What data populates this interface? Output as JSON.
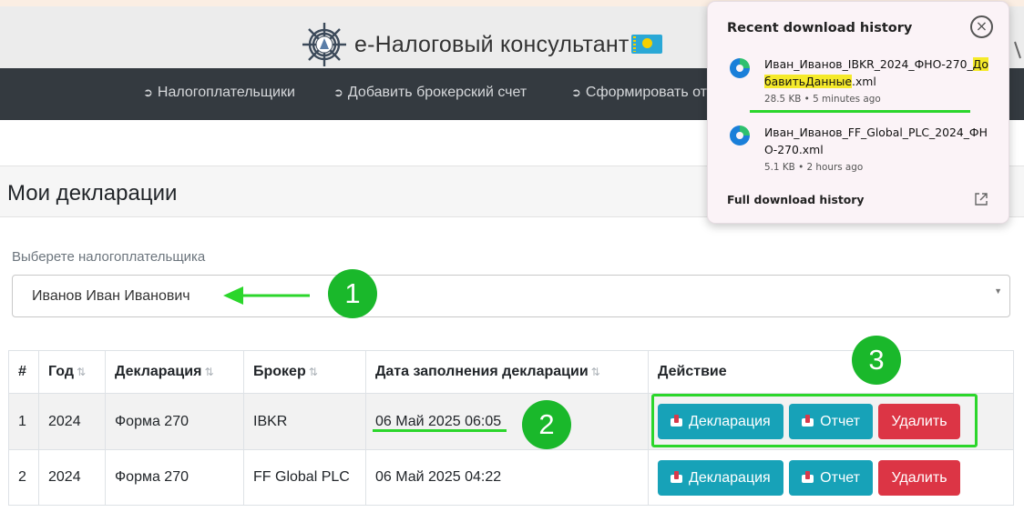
{
  "site": {
    "title": "е-Налоговый консультант",
    "logo_icon": "ship-wheel-icon",
    "flag_icon": "kazakhstan-flag-icon"
  },
  "nav": {
    "items": [
      {
        "label": "Налогоплательщики",
        "icon": "arrow-circle-icon"
      },
      {
        "label": "Добавить брокерский счет",
        "icon": "arrow-circle-icon"
      },
      {
        "label": "Сформировать от",
        "icon": "arrow-circle-icon"
      }
    ]
  },
  "page": {
    "title": "Мои декларации"
  },
  "taxpayer": {
    "label": "Выберете налогоплательщика",
    "value": "Иванов Иван Иванович"
  },
  "table": {
    "columns": [
      "#",
      "Год",
      "Декларация",
      "Брокер",
      "Дата заполнения декларации",
      "Действие"
    ],
    "rows": [
      {
        "num": "1",
        "year": "2024",
        "form": "Форма 270",
        "broker": "IBKR",
        "date": "06 Май 2025 06:05"
      },
      {
        "num": "2",
        "year": "2024",
        "form": "Форма 270",
        "broker": "FF Global PLC",
        "date": "06 Май 2025 04:22"
      }
    ],
    "actions": {
      "declaration": "Декларация",
      "report": "Отчет",
      "delete": "Удалить"
    }
  },
  "annotations": {
    "badge1": "1",
    "badge2": "2",
    "badge3": "3"
  },
  "downloads": {
    "title": "Recent download history",
    "items": [
      {
        "name_plain": "Иван_Иванов_IBKR_2024_ФНО-270_",
        "name_hl": "ДобавитьДанные",
        "name_ext": ".xml",
        "meta": "28.5 KB • 5 minutes ago"
      },
      {
        "name": "Иван_Иванов_FF_Global_PLC_2024_ФНО-270.xml",
        "meta": "5.1 KB • 2 hours ago"
      }
    ],
    "full_history": "Full download history"
  },
  "colors": {
    "nav_bg": "#343a40",
    "btn_info": "#17a2b8",
    "btn_danger": "#dc3545",
    "annotation_green": "#1ab82b",
    "highlight_yellow": "#f5ea2a"
  }
}
